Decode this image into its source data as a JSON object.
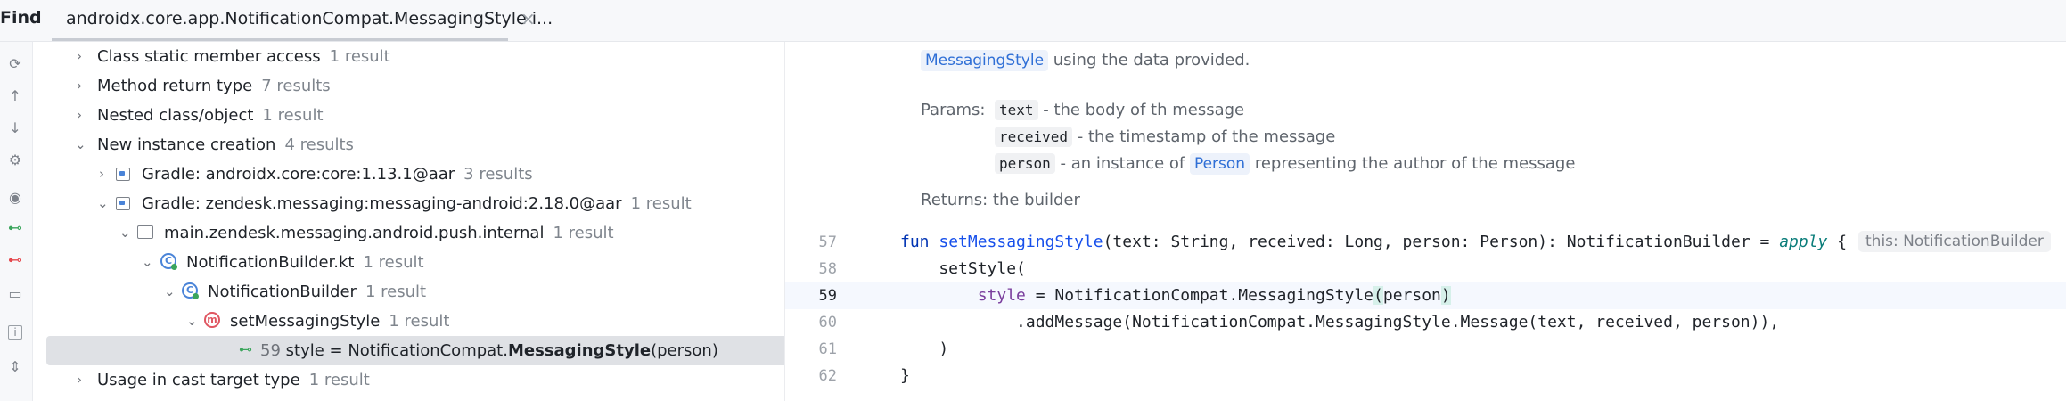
{
  "header": {
    "find_label": "Find",
    "tab_label": "androidx.core.app.NotificationCompat.MessagingStyle i...",
    "close_glyph": "×"
  },
  "left_toolbar_icons": [
    "refresh-icon",
    "arrow-up-icon",
    "arrow-down-icon",
    "settings-icon",
    "eye-icon",
    "show-reads-icon",
    "show-writes-icon",
    "folder-icon",
    "info-icon",
    "expand-collapse-icon"
  ],
  "tree": {
    "rows": [
      {
        "label": "Class static member access",
        "count": "1 result"
      },
      {
        "label": "Method return type",
        "count": "7 results"
      },
      {
        "label": "Nested class/object",
        "count": "1 result"
      },
      {
        "label": "New instance creation",
        "count": "4 results"
      },
      {
        "label": "Gradle: androidx.core:core:1.13.1@aar",
        "count": "3 results"
      },
      {
        "label": "Gradle: zendesk.messaging:messaging-android:2.18.0@aar",
        "count": "1 result"
      },
      {
        "label": "main.zendesk.messaging.android.push.internal",
        "count": "1 result"
      },
      {
        "label": "NotificationBuilder.kt",
        "count": "1 result"
      },
      {
        "label": "NotificationBuilder",
        "count": "1 result"
      },
      {
        "label": "setMessagingStyle",
        "count": "1 result"
      },
      {
        "line": "59",
        "prefix": "style = NotificationCompat.",
        "bold": "MessagingStyle",
        "suffix": "(person)"
      },
      {
        "label": "Usage in cast target type",
        "count": "1 result"
      }
    ]
  },
  "doc": {
    "top_chip": "MessagingStyle",
    "top_text": " using the data provided.",
    "params_label": "Params:",
    "params": [
      {
        "name": "text",
        "desc": " - the body of th message"
      },
      {
        "name": "received",
        "desc": " - the timestamp of the message"
      },
      {
        "name": "person",
        "desc_a": " - an instance of ",
        "link": "Person",
        "desc_b": " representing the author of the message"
      }
    ],
    "returns": "Returns: the builder"
  },
  "editor": {
    "lines": [
      {
        "num": "57"
      },
      {
        "num": "58",
        "text": "    setStyle("
      },
      {
        "num": "59"
      },
      {
        "num": "60",
        "text": "            .addMessage(NotificationCompat.MessagingStyle.Message(text, received, person)),"
      },
      {
        "num": "61",
        "text": "    )"
      },
      {
        "num": "62",
        "text": "}"
      }
    ],
    "l57": {
      "kw": "fun ",
      "fn": "setMessagingStyle",
      "rest": "(text: String, received: Long, person: Person): NotificationBuilder = ",
      "apply": "apply",
      "brace": " {",
      "hint": "this: NotificationBuilder"
    },
    "l59": {
      "indent": "        ",
      "prop": "style",
      "mid": " = NotificationCompat.MessagingStyle",
      "paren": "(",
      "arg": "person",
      "close": ")"
    }
  }
}
